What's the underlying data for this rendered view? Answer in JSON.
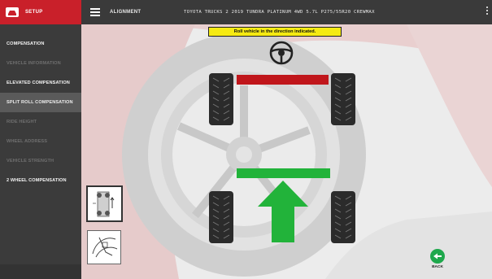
{
  "header": {
    "setup_label": "SETUP",
    "module_label": "ALIGNMENT",
    "vehicle_label": "TOYOTA TRUCKS 2 2019 TUNDRA PLATINUM 4WD 5.7L P275/55R20 CREWMAX",
    "logo_icon": "car-icon",
    "menu_icon": "hamburger-icon",
    "more_icon": "kebab-icon"
  },
  "sidebar": {
    "items": [
      {
        "label": "COMPENSATION",
        "state": "enabled"
      },
      {
        "label": "VEHICLE INFORMATION",
        "state": "disabled"
      },
      {
        "label": "ELEVATED COMPENSATION",
        "state": "enabled"
      },
      {
        "label": "SPLIT ROLL COMPENSATION",
        "state": "active"
      },
      {
        "label": "RIDE HEIGHT",
        "state": "disabled"
      },
      {
        "label": "WHEEL ADDRESS",
        "state": "disabled"
      },
      {
        "label": "VEHICLE STRENGTH",
        "state": "disabled"
      },
      {
        "label": "2 WHEEL COMPENSATION",
        "state": "enabled"
      }
    ]
  },
  "main": {
    "instruction": "Roll vehicle in the direction indicated.",
    "steering_icon": "steering-wheel-icon",
    "rear_indicator_color": "#c0161b",
    "front_indicator_color": "#22b33a",
    "direction_arrow": "arrow-up-icon",
    "thumbnails": [
      "rolling-vehicle-icon",
      "wheel-clamp-icon"
    ],
    "back_label": "BACK",
    "back_icon": "arrow-left-icon"
  },
  "colors": {
    "accent": "#c9202a",
    "toolbar": "#3a3a3a",
    "sidebar": "#3b3b3b",
    "banner": "#f5ea12",
    "go": "#1ea84c"
  }
}
